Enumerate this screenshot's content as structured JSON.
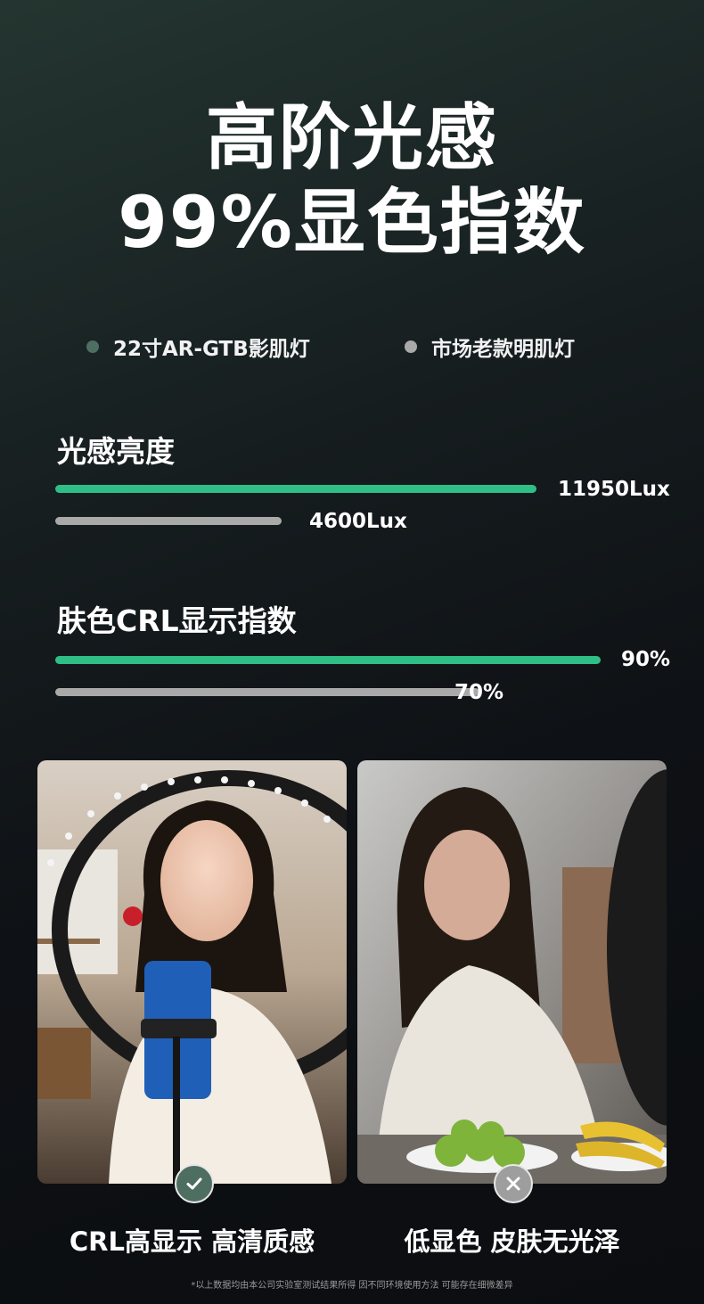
{
  "header": {
    "title_line1": "高阶光感",
    "title_line2": "99%显色指数"
  },
  "legend": [
    {
      "label": "22寸AR-GTB影肌灯",
      "color": "#4f6e62"
    },
    {
      "label": "市场老款明肌灯",
      "color": "#a9a9a9"
    }
  ],
  "metrics": [
    {
      "title": "光感亮度",
      "bars": [
        {
          "label": "11950Lux",
          "fraction": 1.0,
          "color": "#2fbf86"
        },
        {
          "label": "4600Lux",
          "fraction": 0.47,
          "color": "#a9a9a9"
        }
      ]
    },
    {
      "title": "肤色CRL显示指数",
      "bars": [
        {
          "label": "90%",
          "fraction": 0.9,
          "color": "#2fbf86"
        },
        {
          "label": "70%",
          "fraction": 0.7,
          "color": "#a9a9a9"
        }
      ]
    }
  ],
  "comparison": {
    "left": {
      "caption": "CRL高显示 高清质感",
      "badge_icon": "check-icon",
      "badge_color": "#4f6e62"
    },
    "right": {
      "caption": "低显色 皮肤无光泽",
      "badge_icon": "cross-icon",
      "badge_color": "#9e9e9e"
    }
  },
  "footnote": "*以上数据均由本公司实验室测试结果所得 因不同环境使用方法 可能存在细微差异"
}
